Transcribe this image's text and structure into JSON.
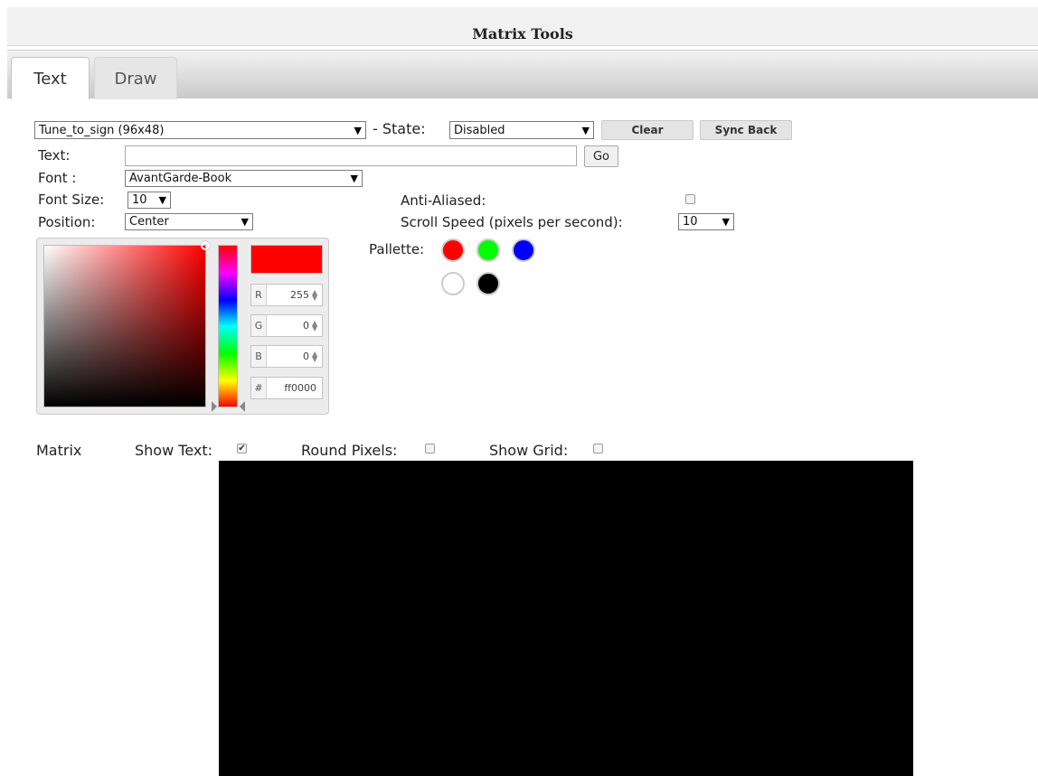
{
  "app": {
    "title": "Matrix Tools"
  },
  "tabs": [
    {
      "label": "Text",
      "active": true
    },
    {
      "label": "Draw",
      "active": false
    }
  ],
  "sign_select": {
    "value": "Tune_to_sign (96x48)"
  },
  "state": {
    "label": "- State:",
    "value": "Disabled"
  },
  "buttons": {
    "clear": "Clear",
    "sync_back": "Sync Back",
    "go": "Go"
  },
  "text_field": {
    "label": "Text:",
    "value": ""
  },
  "font": {
    "label": "Font :",
    "value": "AvantGarde-Book"
  },
  "font_size": {
    "label": "Font Size:",
    "value": "10"
  },
  "position": {
    "label": "Position:",
    "value": "Center"
  },
  "anti_aliased": {
    "label": "Anti-Aliased:",
    "checked": false
  },
  "scroll_speed": {
    "label": "Scroll Speed (pixels per second):",
    "value": "10"
  },
  "picker": {
    "hex_color": "#ff0000",
    "r": {
      "key": "R",
      "value": "255"
    },
    "g": {
      "key": "G",
      "value": "0"
    },
    "b": {
      "key": "B",
      "value": "0"
    },
    "hex": {
      "key": "#",
      "value": "ff0000"
    }
  },
  "pallette": {
    "label": "Pallette:",
    "colors": [
      "#ff0000",
      "#00ff00",
      "#0000ff",
      "#ffffff",
      "#000000"
    ]
  },
  "matrix_options": {
    "label": "Matrix",
    "show_text": {
      "label": "Show Text:",
      "checked": true
    },
    "round_pixels": {
      "label": "Round Pixels:",
      "checked": false
    },
    "show_grid": {
      "label": "Show Grid:",
      "checked": false
    }
  },
  "matrix_canvas": {
    "color": "#000000"
  }
}
